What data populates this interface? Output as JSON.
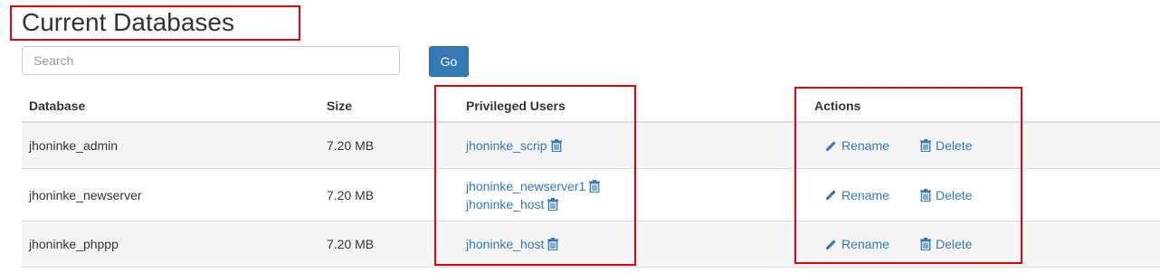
{
  "header": {
    "title": "Current Databases"
  },
  "search": {
    "placeholder": "Search",
    "go_label": "Go"
  },
  "table": {
    "columns": {
      "database": "Database",
      "size": "Size",
      "users": "Privileged Users",
      "actions": "Actions"
    },
    "rows": [
      {
        "database": "jhoninke_admin",
        "size": "7.20 MB",
        "users": [
          "jhoninke_scrip"
        ],
        "rename": "Rename",
        "delete": "Delete"
      },
      {
        "database": "jhoninke_newserver",
        "size": "7.20 MB",
        "users": [
          "jhoninke_newserver1",
          "jhoninke_host"
        ],
        "rename": "Rename",
        "delete": "Delete"
      },
      {
        "database": "jhoninke_phppp",
        "size": "7.20 MB",
        "users": [
          "jhoninke_host"
        ],
        "rename": "Rename",
        "delete": "Delete"
      }
    ]
  },
  "icons": {
    "user_remove": "trash-icon",
    "rename": "pencil-icon",
    "delete": "trash-icon"
  },
  "colors": {
    "link": "#337ab7",
    "go_button": "#337ab7",
    "highlight": "#e8000b",
    "row_alt": "#f5f5f5"
  }
}
